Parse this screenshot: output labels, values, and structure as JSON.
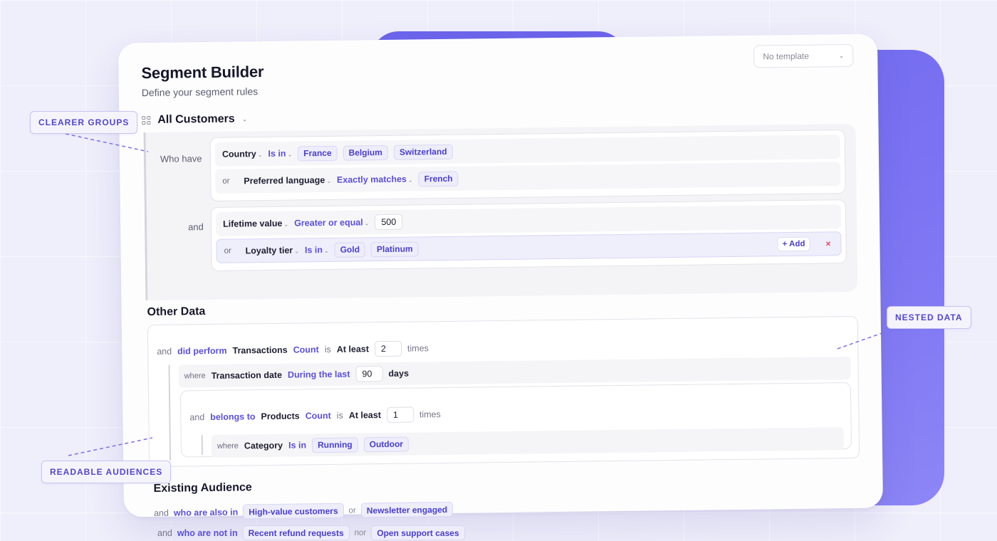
{
  "header": {
    "title": "Segment Builder",
    "subtitle": "Define your segment rules",
    "template_select": "No template"
  },
  "audience": {
    "title": "All Customers",
    "who_have_label": "Who have",
    "and_label": "and",
    "group1": [
      {
        "connector": "",
        "field": "Country",
        "operator": "Is in",
        "values": [
          "France",
          "Belgium",
          "Switzerland"
        ]
      },
      {
        "connector": "or",
        "field": "Preferred language",
        "operator": "Exactly matches",
        "values": [
          "French"
        ]
      }
    ],
    "group2": [
      {
        "connector": "",
        "field": "Lifetime value",
        "operator": "Greater or equal",
        "number": "500"
      },
      {
        "connector": "or",
        "field": "Loyalty tier",
        "operator": "Is in",
        "values": [
          "Gold",
          "Platinum"
        ],
        "add_label": "+ Add",
        "remove_label": "×"
      }
    ]
  },
  "other_data": {
    "title": "Other Data",
    "line1": {
      "connector": "and",
      "verb": "did perform",
      "entity": "Transactions",
      "metric": "Count",
      "is": "is",
      "comparator": "At least",
      "number": "2",
      "unit": "times"
    },
    "where1": {
      "where": "where",
      "field": "Transaction date",
      "operator": "During the last",
      "number": "90",
      "unit": "days"
    },
    "line2": {
      "connector": "and",
      "verb": "belongs to",
      "entity": "Products",
      "metric": "Count",
      "is": "is",
      "comparator": "At least",
      "number": "1",
      "unit": "times"
    },
    "where2": {
      "where": "where",
      "field": "Category",
      "operator": "Is in",
      "values": [
        "Running",
        "Outdoor"
      ]
    }
  },
  "existing_audience": {
    "title": "Existing Audience",
    "line1": {
      "connector": "and",
      "verb": "who are also in",
      "values": [
        "High-value customers",
        "Newsletter engaged"
      ],
      "joiner": "or"
    },
    "line2": {
      "connector": "and",
      "verb": "who are not in",
      "values": [
        "Recent refund requests",
        "Open support cases"
      ],
      "joiner": "nor"
    }
  },
  "callouts": {
    "clearer_groups": "CLEARER GROUPS",
    "nested_data": "NESTED DATA",
    "readable_audiences": "READABLE AUDIENCES"
  },
  "colors": {
    "accent": "#5b50d6",
    "blob": "#7069ef",
    "chip_bg": "#eeedfb",
    "remove": "#e0435d"
  }
}
